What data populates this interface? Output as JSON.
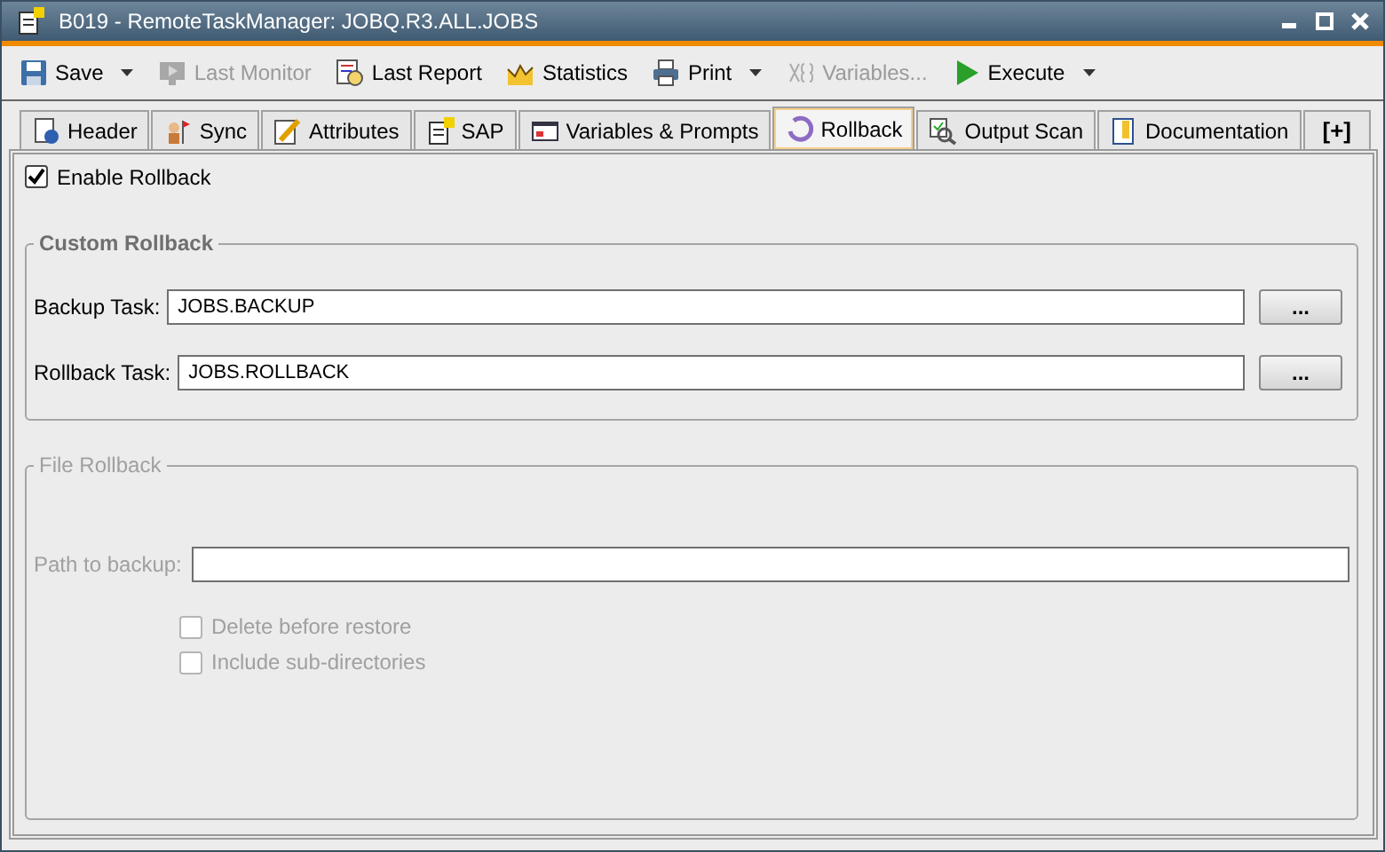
{
  "window": {
    "title": "B019 - RemoteTaskManager: JOBQ.R3.ALL.JOBS"
  },
  "toolbar": [
    {
      "label": "Save",
      "disabled": false,
      "has_menu": true
    },
    {
      "label": "Last Monitor",
      "disabled": true,
      "has_menu": false
    },
    {
      "label": "Last Report",
      "disabled": false,
      "has_menu": false
    },
    {
      "label": "Statistics",
      "disabled": false,
      "has_menu": false
    },
    {
      "label": "Print",
      "disabled": false,
      "has_menu": true
    },
    {
      "label": "Variables...",
      "disabled": true,
      "has_menu": false
    },
    {
      "label": "Execute",
      "disabled": false,
      "has_menu": true
    }
  ],
  "tabs": [
    {
      "label": "Header",
      "selected": false
    },
    {
      "label": "Sync",
      "selected": false
    },
    {
      "label": "Attributes",
      "selected": false
    },
    {
      "label": "SAP",
      "selected": false
    },
    {
      "label": "Variables & Prompts",
      "selected": false
    },
    {
      "label": "Rollback",
      "selected": true
    },
    {
      "label": "Output Scan",
      "selected": false
    },
    {
      "label": "Documentation",
      "selected": false
    },
    {
      "label": "[+]",
      "selected": false
    }
  ],
  "enable_rollback": {
    "label": "Enable Rollback",
    "checked": true
  },
  "custom_rollback": {
    "title": "Custom Rollback",
    "disabled": false,
    "fields": [
      {
        "label": "Backup Task:",
        "value": "JOBS.BACKUP",
        "button": "..."
      },
      {
        "label": "Rollback Task:",
        "value": "JOBS.ROLLBACK",
        "button": "..."
      }
    ]
  },
  "file_rollback": {
    "title": "File Rollback",
    "disabled": true,
    "path_label": "Path to backup:",
    "options": [
      {
        "label": "Delete before restore",
        "checked": false
      },
      {
        "label": "Include sub-directories",
        "checked": false
      }
    ]
  }
}
